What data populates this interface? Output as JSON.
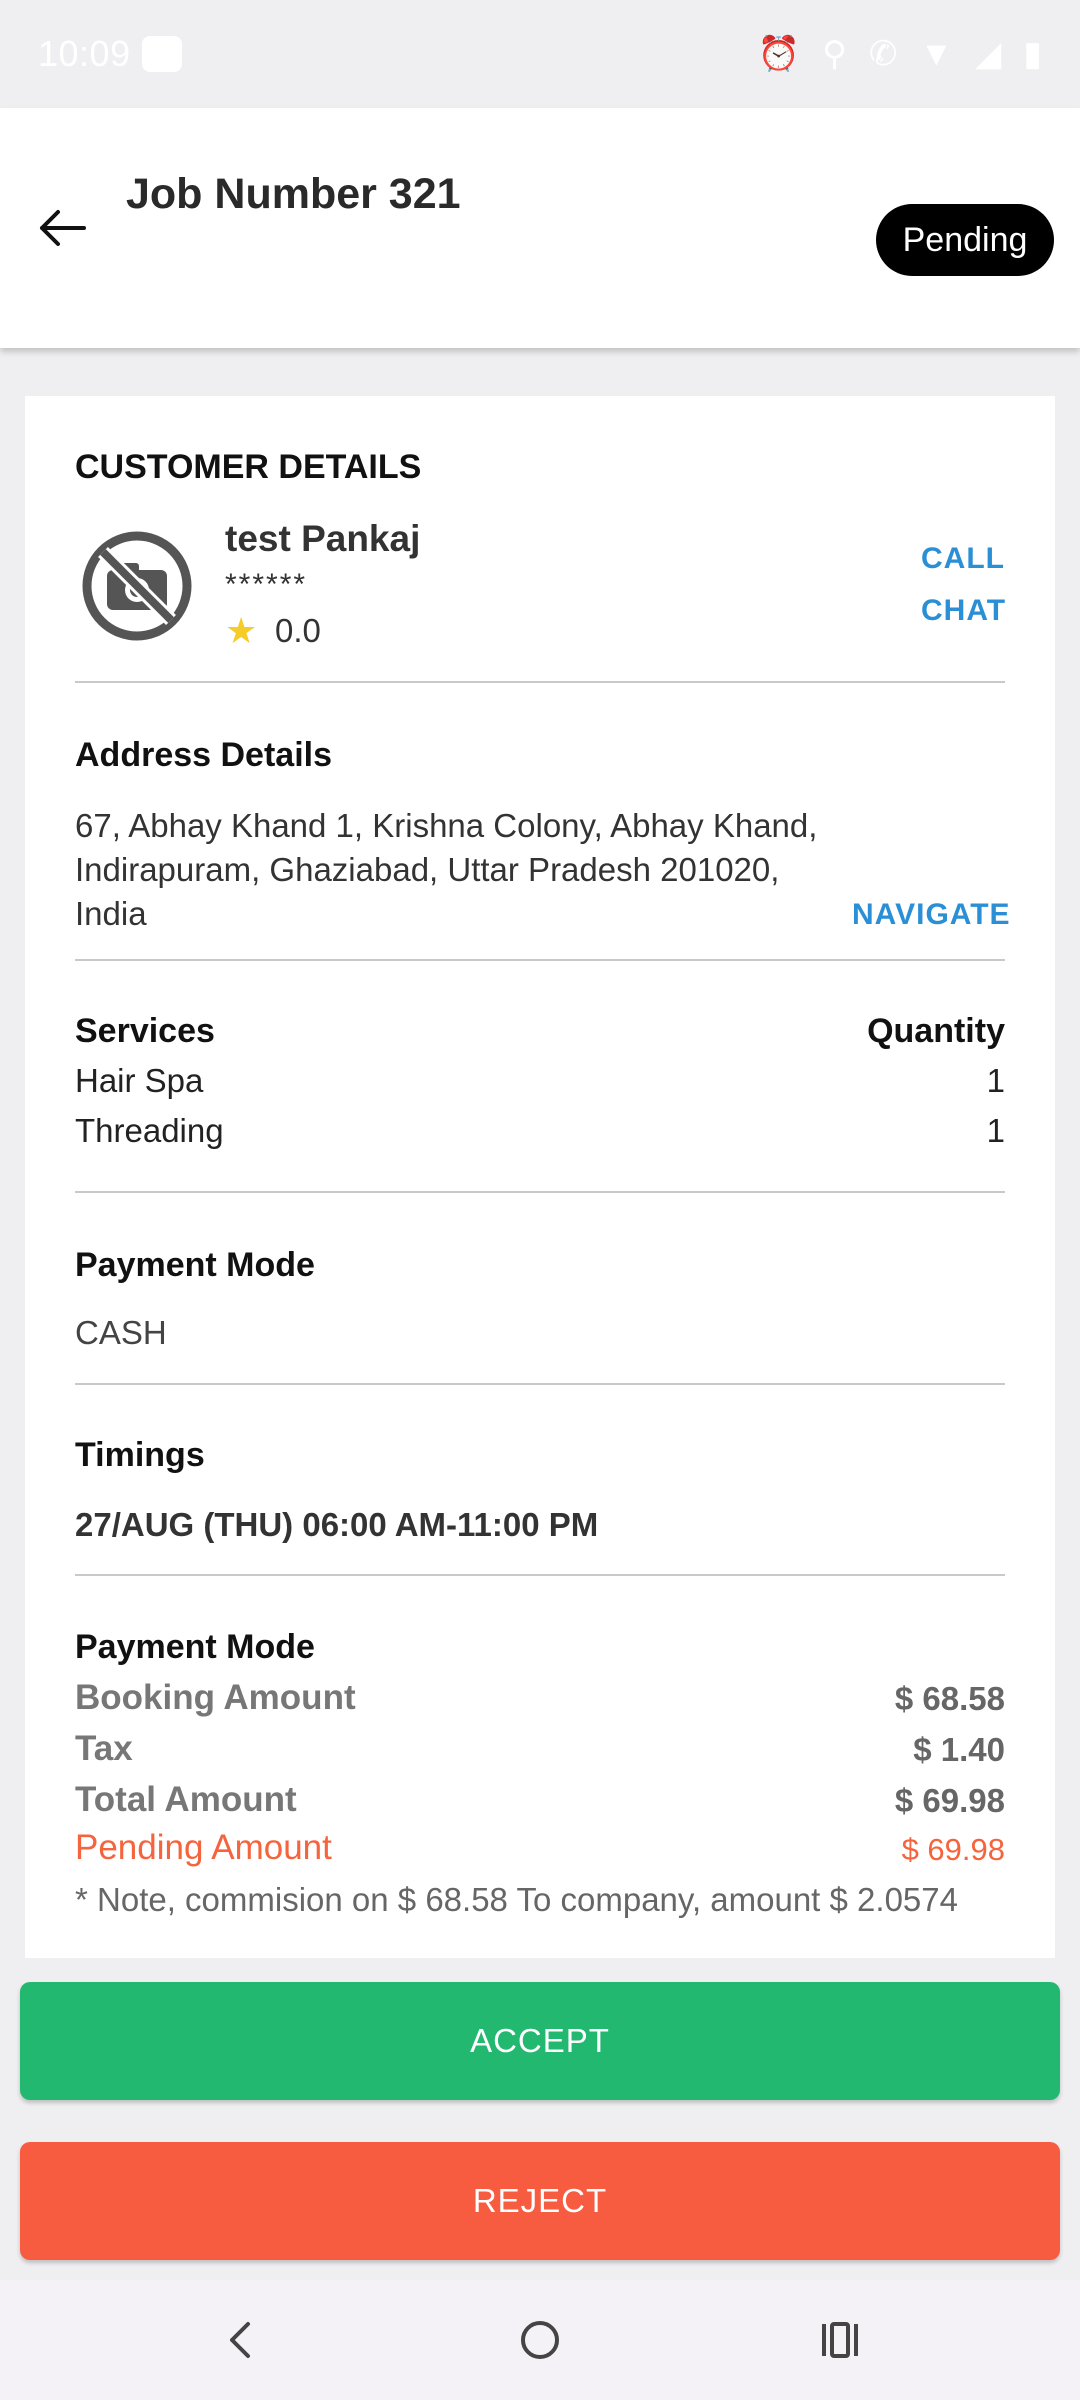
{
  "status_bar": {
    "time": "10:09"
  },
  "header": {
    "title": "Job Number 321",
    "status": "Pending"
  },
  "customer": {
    "heading": "CUSTOMER DETAILS",
    "name": "test Pankaj",
    "phone": "******",
    "rating": "0.0",
    "call_label": "CALL",
    "chat_label": "CHAT"
  },
  "address": {
    "heading": "Address Details",
    "text": "67, Abhay Khand 1, Krishna Colony, Abhay Khand, Indirapuram, Ghaziabad, Uttar Pradesh 201020, India",
    "navigate_label": "NAVIGATE"
  },
  "services": {
    "heading": "Services",
    "quantity_heading": "Quantity",
    "items": [
      {
        "name": "Hair Spa",
        "qty": "1"
      },
      {
        "name": "Threading",
        "qty": "1"
      }
    ]
  },
  "payment_mode": {
    "heading": "Payment Mode",
    "value": "CASH"
  },
  "timings": {
    "heading": "Timings",
    "value": "27/AUG (THU) 06:00 AM-11:00 PM"
  },
  "payment_summary": {
    "heading": "Payment Mode",
    "booking_label": "Booking Amount",
    "booking_value": "$ 68.58",
    "tax_label": "Tax",
    "tax_value": "$ 1.40",
    "total_label": "Total Amount",
    "total_value": "$ 69.98",
    "pending_label": "Pending Amount",
    "pending_value": "$ 69.98",
    "note": "* Note, commision on $ 68.58 To company, amount $ 2.0574"
  },
  "actions": {
    "accept_label": "ACCEPT",
    "reject_label": "REJECT"
  },
  "colors": {
    "accept": "#22b86f",
    "reject": "#f75b40",
    "link": "#2b8fd6",
    "pending": "#f4643d",
    "badge": "#000000"
  }
}
